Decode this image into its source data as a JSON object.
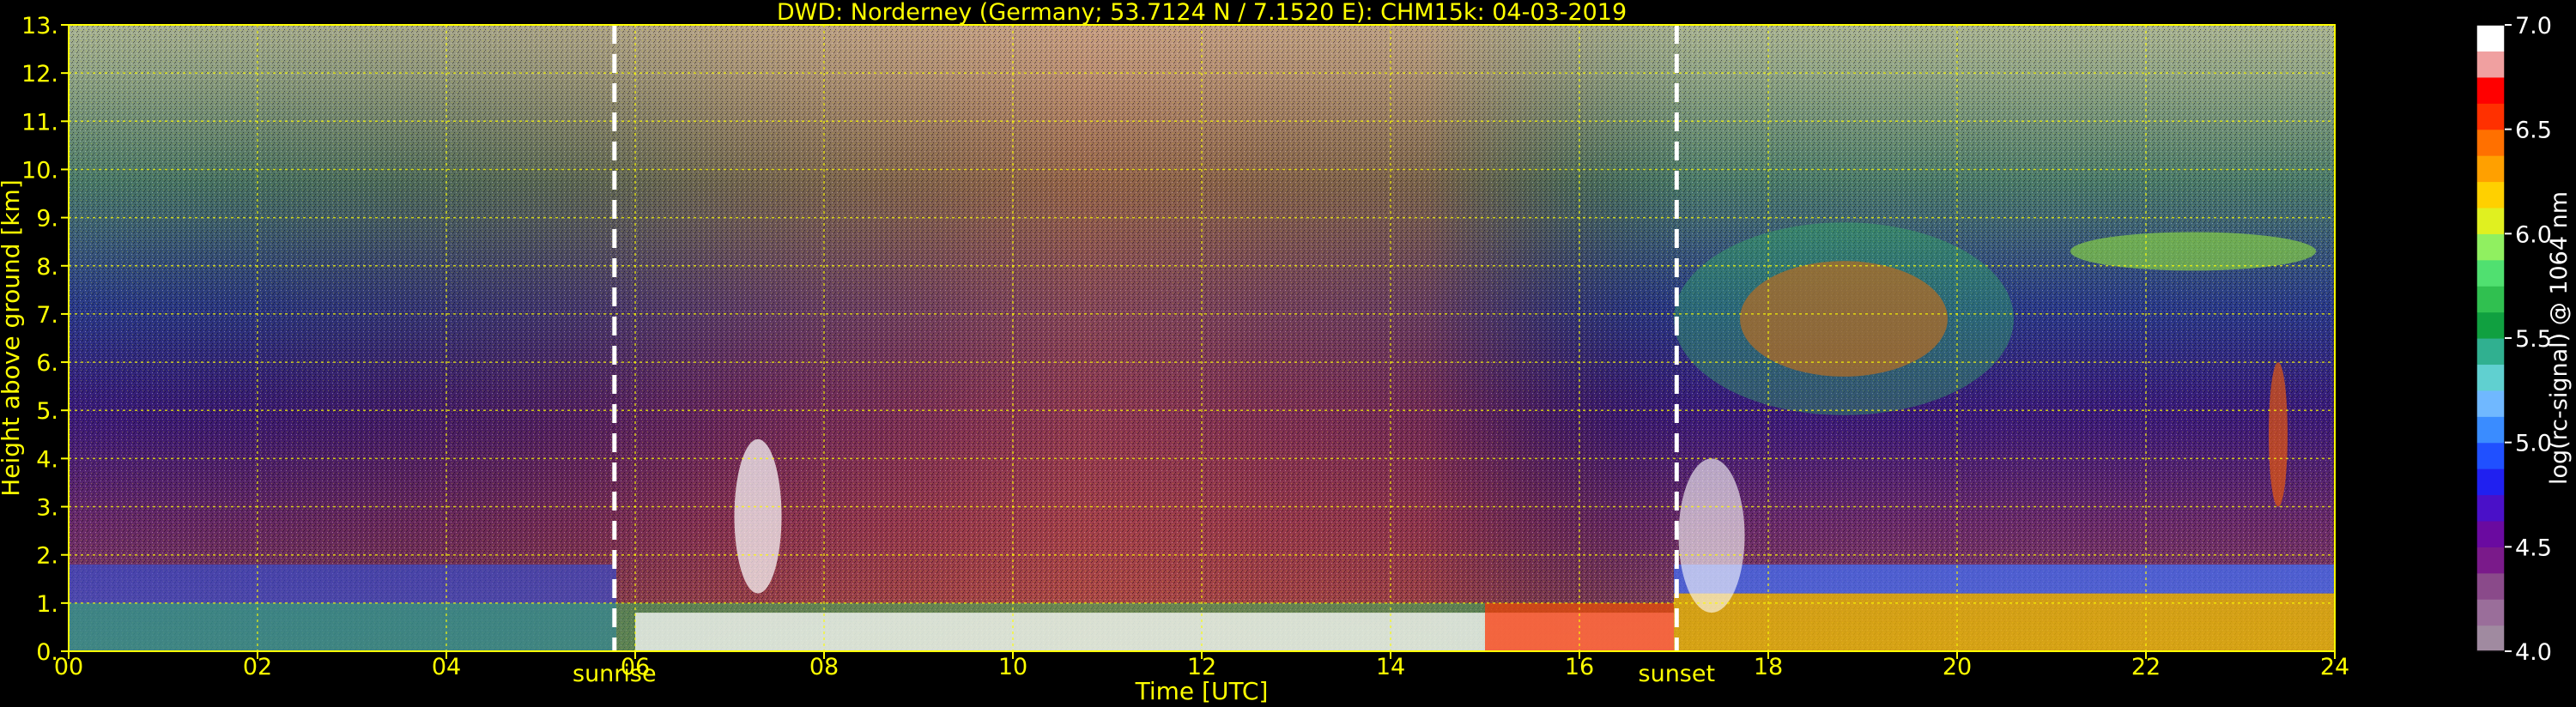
{
  "chart_data": {
    "type": "heatmap",
    "title": "DWD: Norderney (Germany; 53.7124 N / 7.1520 E):    CHM15k: 04-03-2019",
    "xlabel": "Time [UTC]",
    "ylabel": "Height above ground [km]",
    "xlim": [
      0,
      24
    ],
    "ylim": [
      0,
      13
    ],
    "x_ticks": [
      "00",
      "02",
      "04",
      "06",
      "08",
      "10",
      "12",
      "14",
      "16",
      "18",
      "20",
      "22",
      "24"
    ],
    "y_ticks": [
      "0.",
      "1.",
      "2.",
      "3.",
      "4.",
      "5.",
      "6.",
      "7.",
      "8.",
      "9.",
      "10.",
      "11.",
      "12.",
      "13."
    ],
    "grid": true,
    "grid_color": "#ffff00",
    "colorbar": {
      "label": "log(rc-signal) @ 1064 nm",
      "range": [
        4.0,
        7.0
      ],
      "ticks": [
        "4.0",
        "4.5",
        "5.0",
        "5.5",
        "6.0",
        "6.5",
        "7.0"
      ],
      "colors": [
        "#a08aa0",
        "#9a6e9a",
        "#8a4a8a",
        "#7a1a8a",
        "#6a0aa0",
        "#4a10c8",
        "#2020f0",
        "#2050ff",
        "#3a8cff",
        "#70b8ff",
        "#60d0d0",
        "#30b090",
        "#10a040",
        "#30c050",
        "#50e070",
        "#90f060",
        "#e0f020",
        "#ffd000",
        "#ffa000",
        "#ff7000",
        "#ff3000",
        "#ff0000",
        "#f0a0a0",
        "#ffffff"
      ]
    },
    "annotations": [
      {
        "text": "sunrise",
        "x": 5.78
      },
      {
        "text": "sunset",
        "x": 17.03
      }
    ]
  }
}
